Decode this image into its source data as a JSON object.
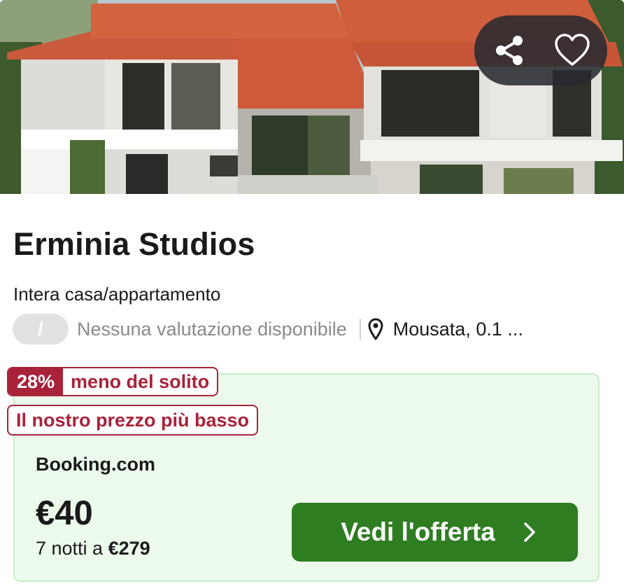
{
  "listing": {
    "name": "Erminia Studios",
    "type": "Intera casa/appartamento",
    "rating_badge": "/",
    "rating_text": "Nessuna valutazione disponibile",
    "location": "Mousata, 0.1 ..."
  },
  "photo": {
    "share_icon": "share-icon",
    "favorite_icon": "heart-icon"
  },
  "deal": {
    "discount_percent": "28%",
    "discount_text": "meno del solito",
    "lowest_price_label": "Il nostro prezzo più basso",
    "provider": "Booking.com",
    "price": "€40",
    "total_prefix": "7 notti a",
    "total_price": "€279",
    "cta_label": "Vedi l'offerta",
    "cta_icon": "chevron-right-icon"
  },
  "colors": {
    "accent_red": "#a8233a",
    "cta_green": "#2e7d21",
    "deal_bg": "#ecfaec",
    "deal_border": "#c6ecc6"
  }
}
